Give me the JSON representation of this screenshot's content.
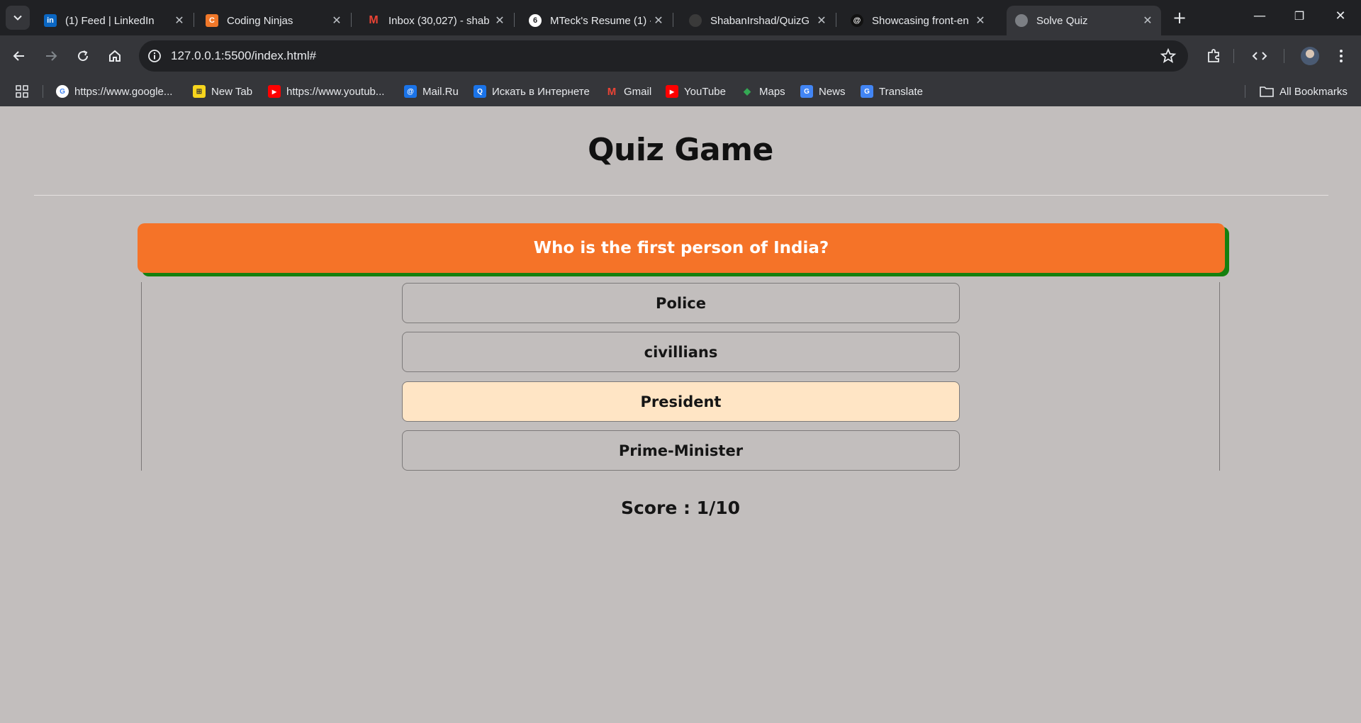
{
  "browser": {
    "tabs": [
      {
        "title": "(1) Feed | LinkedIn",
        "icon": "linkedin-icon",
        "color": "#0a66c2",
        "glyph": "in"
      },
      {
        "title": "Coding Ninjas",
        "icon": "coding-ninjas-icon",
        "color": "#f0782a",
        "glyph": "C"
      },
      {
        "title": "Inbox (30,027) - shab",
        "icon": "gmail-icon",
        "color": "#ea4335",
        "glyph": "M"
      },
      {
        "title": "MTeck's Resume (1) -",
        "icon": "resume-icon",
        "color": "#ffffff",
        "glyph": "6"
      },
      {
        "title": "ShabanIrshad/QuizG",
        "icon": "github-icon",
        "color": "#3a3a3a",
        "glyph": ""
      },
      {
        "title": "Showcasing front-en",
        "icon": "threads-icon",
        "color": "#111111",
        "glyph": "@"
      },
      {
        "title": "Solve Quiz",
        "icon": "globe-icon",
        "color": "#7c7f84",
        "glyph": ""
      }
    ],
    "active_tab_index": 6,
    "url": "127.0.0.1:5500/index.html#",
    "bookmarks": [
      {
        "label": "https://www.google...",
        "icon": "google-icon",
        "color": "#ffffff",
        "glyph": "G"
      },
      {
        "label": "New Tab",
        "icon": "new-tab-icon",
        "color": "#f7d51d",
        "glyph": "⊞"
      },
      {
        "label": "https://www.youtub...",
        "icon": "youtube-icon",
        "color": "#ff0000",
        "glyph": "▶"
      },
      {
        "label": "Mail.Ru",
        "icon": "mailru-icon",
        "color": "#1a73e8",
        "glyph": "@"
      },
      {
        "label": "Искать в Интернете",
        "icon": "search-web-icon",
        "color": "#1a73e8",
        "glyph": "Q"
      },
      {
        "label": "Gmail",
        "icon": "gmail-icon",
        "color": "#ea4335",
        "glyph": "M"
      },
      {
        "label": "YouTube",
        "icon": "youtube-icon",
        "color": "#ff0000",
        "glyph": "▶"
      },
      {
        "label": "Maps",
        "icon": "maps-icon",
        "color": "#34a853",
        "glyph": "◆"
      },
      {
        "label": "News",
        "icon": "news-icon",
        "color": "#4285f4",
        "glyph": "G"
      },
      {
        "label": "Translate",
        "icon": "translate-icon",
        "color": "#4285f4",
        "glyph": "G"
      }
    ],
    "all_bookmarks": "All Bookmarks"
  },
  "quiz": {
    "title": "Quiz Game",
    "question": "Who is the first person of India?",
    "options": [
      "Police",
      "civillians",
      "President",
      "Prime-Minister"
    ],
    "selected_option_index": 2,
    "score_label": "Score : 1/10"
  },
  "colors": {
    "page_background": "#c2bebd",
    "question_background": "#f57328",
    "question_shadow": "#15800f",
    "selected_option": "#ffe5c5"
  }
}
